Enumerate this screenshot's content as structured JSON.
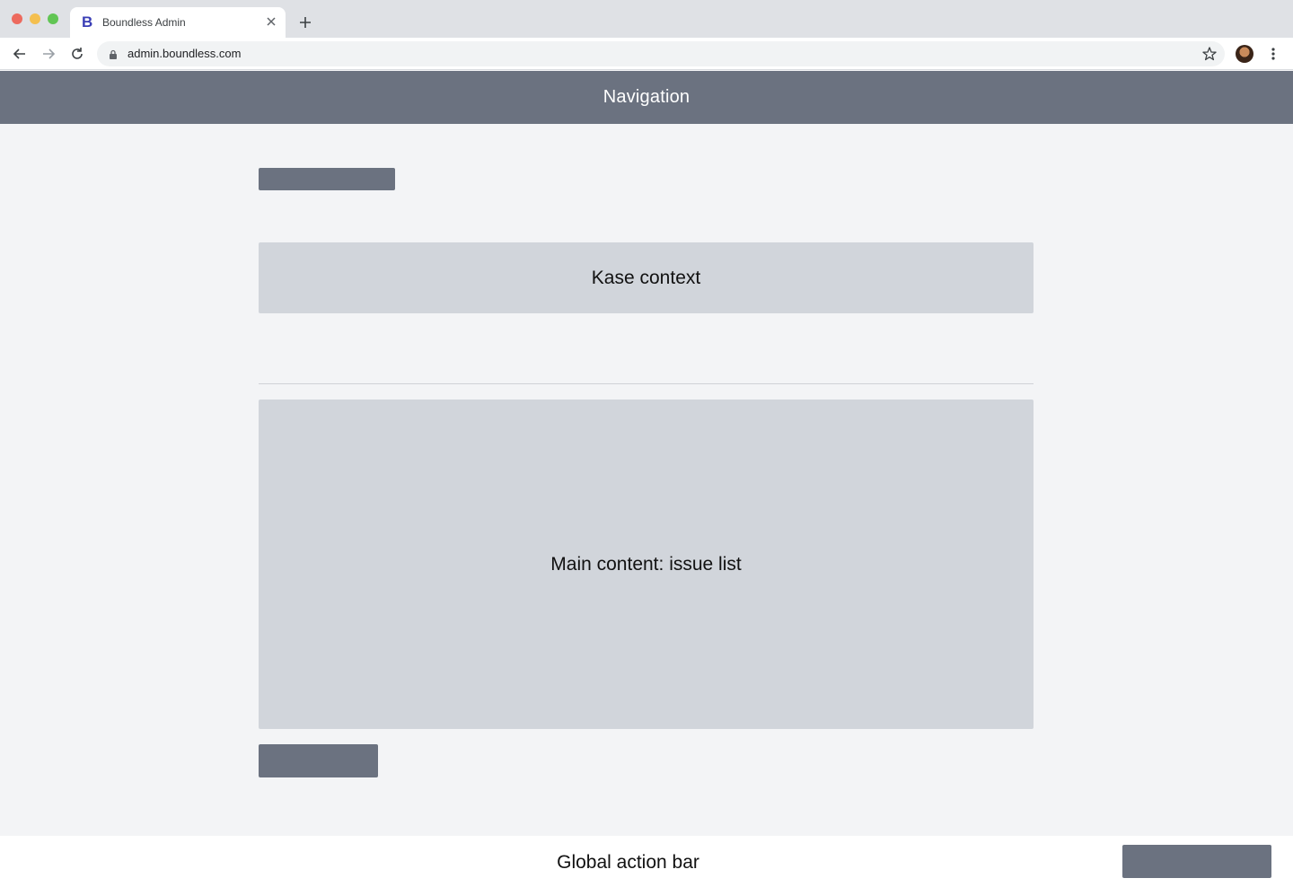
{
  "browser": {
    "tab": {
      "favicon": "B",
      "title": "Boundless Admin"
    },
    "address": {
      "url": "admin.boundless.com"
    },
    "icons": [
      "close-icon",
      "plus-icon",
      "back-icon",
      "forward-icon",
      "reload-icon",
      "lock-icon",
      "star-icon",
      "avatar",
      "menu-icon"
    ]
  },
  "app": {
    "navigation": {
      "label": "Navigation"
    },
    "kase_context": {
      "label": "Kase context"
    },
    "main_content": {
      "label": "Main content: issue list"
    },
    "action_bar": {
      "label": "Global action bar"
    }
  },
  "colors": {
    "nav_bg": "#6b7280",
    "panel_bg": "#d1d5db",
    "page_bg": "#f3f4f6",
    "favicon": "#3b3fb6"
  }
}
